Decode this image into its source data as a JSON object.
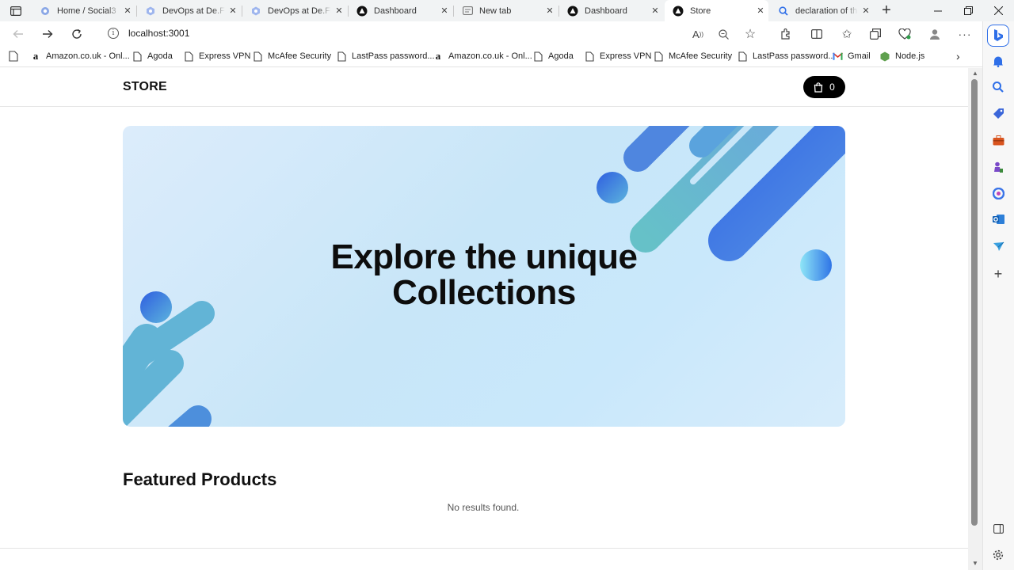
{
  "browser": {
    "tabs": [
      {
        "title": "Home / Social3",
        "icon": "social-favicon",
        "active": false
      },
      {
        "title": "DevOps at De.Fi /",
        "icon": "defi-favicon",
        "active": false
      },
      {
        "title": "DevOps at De.Fi /",
        "icon": "defi-favicon",
        "active": false
      },
      {
        "title": "Dashboard",
        "icon": "triangle-favicon",
        "active": false
      },
      {
        "title": "New tab",
        "icon": "newtab-favicon",
        "active": false
      },
      {
        "title": "Dashboard",
        "icon": "triangle-favicon",
        "active": false
      },
      {
        "title": "Store",
        "icon": "triangle-favicon",
        "active": true
      },
      {
        "title": "declaration of thr",
        "icon": "search-favicon",
        "active": false
      }
    ],
    "url": "localhost:3001",
    "bookmarks": [
      {
        "label": "Amazon.co.uk - Onl...",
        "icon": "amazon-icon"
      },
      {
        "label": "Agoda",
        "icon": "page-icon"
      },
      {
        "label": "Express VPN",
        "icon": "page-icon"
      },
      {
        "label": "McAfee Security",
        "icon": "page-icon"
      },
      {
        "label": "LastPass password...",
        "icon": "page-icon"
      },
      {
        "label": "Amazon.co.uk - Onl...",
        "icon": "amazon-icon"
      },
      {
        "label": "Agoda",
        "icon": "page-icon"
      },
      {
        "label": "Express VPN",
        "icon": "page-icon"
      },
      {
        "label": "McAfee Security",
        "icon": "page-icon"
      },
      {
        "label": "LastPass password...",
        "icon": "page-icon"
      },
      {
        "label": "Gmail",
        "icon": "gmail-icon"
      },
      {
        "label": "Node.js",
        "icon": "nodejs-icon"
      }
    ]
  },
  "store": {
    "logo": "STORE",
    "cart_count": "0",
    "hero_line1": "Explore the unique",
    "hero_line2": "Collections",
    "featured_heading": "Featured Products",
    "empty_message": "No results found."
  },
  "colors": {
    "accent": "#000000",
    "hero_bg": "#c8e6f8",
    "shape_blue": "#3f6fe0",
    "shape_teal": "#5fb8c9"
  }
}
